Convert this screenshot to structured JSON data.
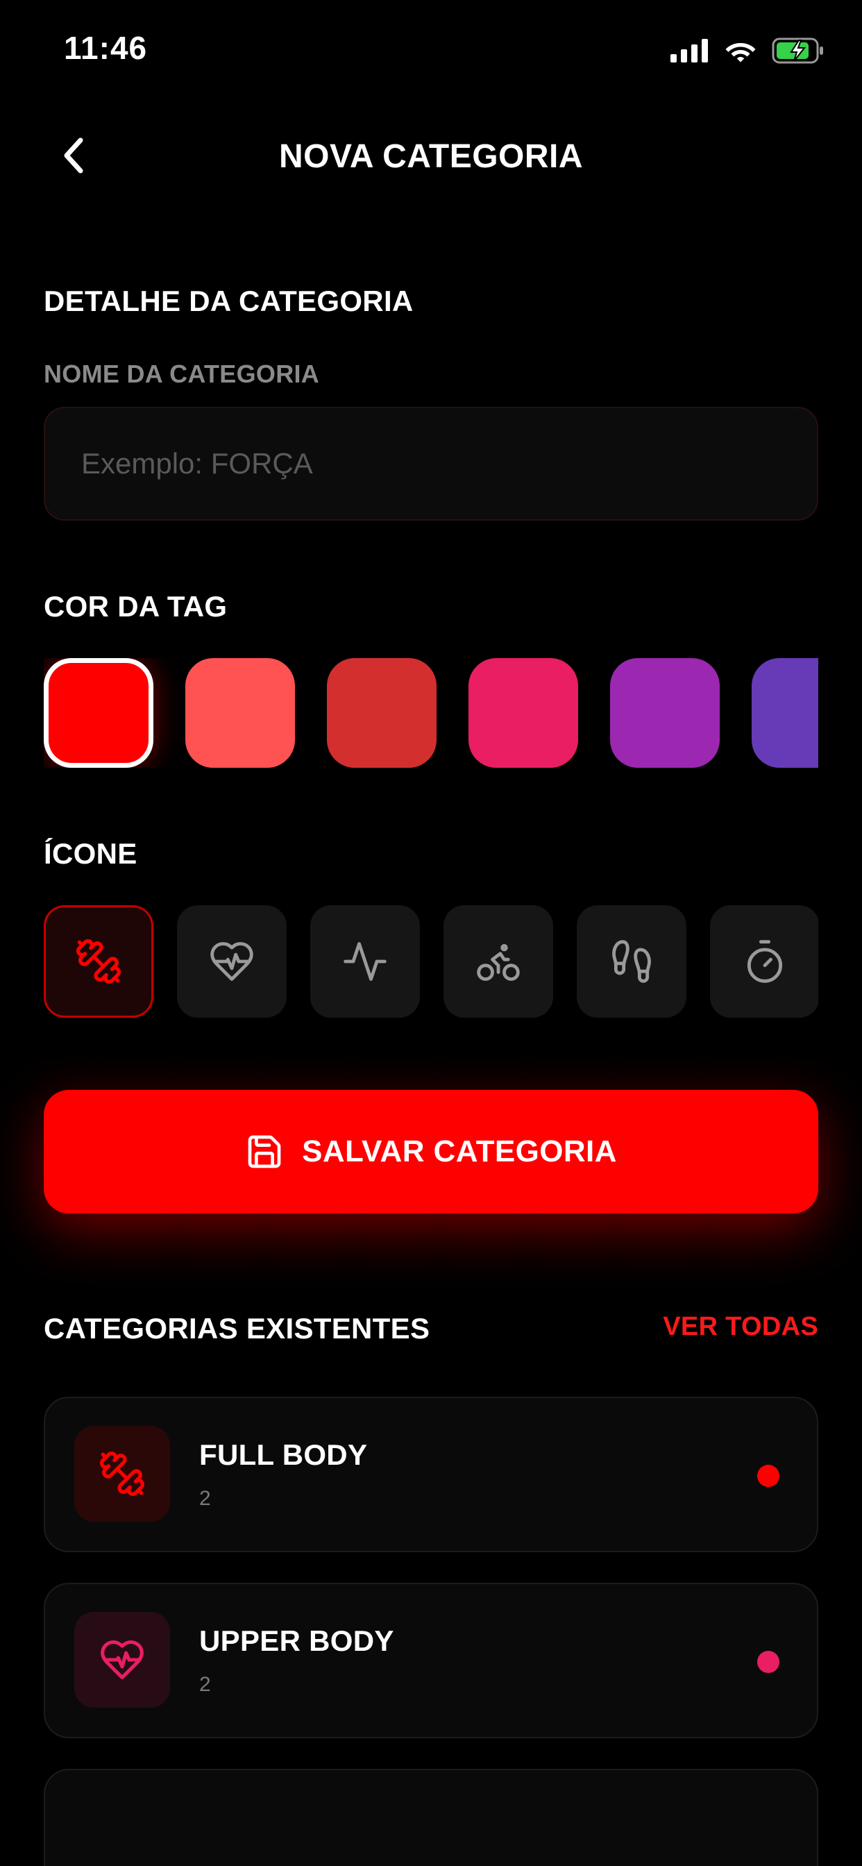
{
  "status_bar": {
    "time": "11:46"
  },
  "header": {
    "title": "NOVA CATEGORIA"
  },
  "details": {
    "section_title": "DETALHE DA CATEGORIA",
    "name_label": "NOME DA CATEGORIA",
    "name_placeholder": "Exemplo: FORÇA",
    "name_value": ""
  },
  "tag_color": {
    "section_title": "COR DA TAG",
    "selected_index": 0,
    "colors": [
      "#ff0000",
      "#ff5252",
      "#d32f2f",
      "#e91e63",
      "#9c27b0",
      "#673ab7"
    ]
  },
  "icon_picker": {
    "section_title": "ÍCONE",
    "selected_index": 0,
    "icons": [
      "dumbbell-icon",
      "heart-pulse-icon",
      "activity-icon",
      "bike-icon",
      "footprints-icon",
      "timer-icon"
    ]
  },
  "save_button": {
    "label": "SALVAR CATEGORIA",
    "icon": "save-icon"
  },
  "existing": {
    "section_title": "CATEGORIAS EXISTENTES",
    "see_all": "VER TODAS",
    "items": [
      {
        "name": "FULL BODY",
        "count": "2",
        "icon": "dumbbell-icon",
        "color": "#ff0000"
      },
      {
        "name": "UPPER BODY",
        "count": "2",
        "icon": "heart-pulse-icon",
        "color": "#e91e63"
      }
    ]
  },
  "colors": {
    "accent": "#ff0000",
    "background": "#000000",
    "muted_text": "#8a8a8a",
    "icon_muted": "#9a9a9a"
  }
}
